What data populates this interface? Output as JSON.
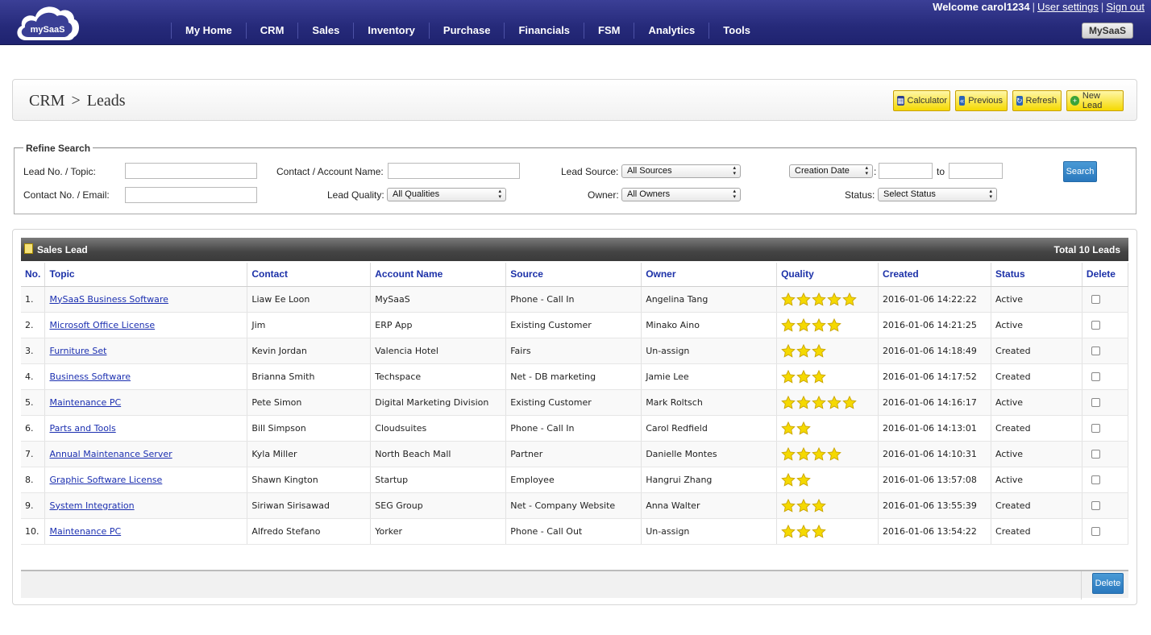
{
  "header": {
    "logo_text": "mySaaS",
    "welcome_prefix": "Welcome",
    "username": "carol1234",
    "user_settings": "User settings",
    "sign_out": "Sign out",
    "brand_button": "MySaaS",
    "nav": [
      "My Home",
      "CRM",
      "Sales",
      "Inventory",
      "Purchase",
      "Financials",
      "FSM",
      "Analytics",
      "Tools"
    ]
  },
  "page": {
    "crumb_root": "CRM",
    "crumb_sep": ">",
    "crumb_leaf": "Leads",
    "buttons": {
      "calculator": "Calculator",
      "previous": "Previous",
      "refresh": "Refresh",
      "new_lead": "New Lead"
    }
  },
  "search": {
    "legend": "Refine Search",
    "lead_no_label": "Lead No. / Topic:",
    "contact_no_label": "Contact No. / Email:",
    "contact_account_label": "Contact / Account Name:",
    "lead_quality_label": "Lead Quality:",
    "lead_quality_value": "All Qualities",
    "lead_source_label": "Lead Source:",
    "lead_source_value": "All Sources",
    "owner_label": "Owner:",
    "owner_value": "All Owners",
    "date_field_value": "Creation Date",
    "date_colon": ":",
    "to_label": "to",
    "status_label": "Status:",
    "status_value": "Select Status",
    "search_button": "Search"
  },
  "grid": {
    "title": "Sales Lead",
    "total": "Total 10 Leads",
    "columns": [
      "No.",
      "Topic",
      "Contact",
      "Account Name",
      "Source",
      "Owner",
      "Quality",
      "Created",
      "Status",
      "Delete"
    ],
    "rows": [
      {
        "no": "1.",
        "topic": "MySaaS Business Software",
        "contact": "Liaw Ee Loon",
        "account": "MySaaS",
        "source": "Phone - Call In",
        "owner": "Angelina Tang",
        "quality": 5,
        "created": "2016-01-06 14:22:22",
        "status": "Active"
      },
      {
        "no": "2.",
        "topic": "Microsoft Office License",
        "contact": "Jim",
        "account": "ERP App",
        "source": "Existing Customer",
        "owner": "Minako Aino",
        "quality": 4,
        "created": "2016-01-06 14:21:25",
        "status": "Active"
      },
      {
        "no": "3.",
        "topic": "Furniture Set",
        "contact": "Kevin Jordan",
        "account": "Valencia Hotel",
        "source": "Fairs",
        "owner": "Un-assign",
        "quality": 3,
        "created": "2016-01-06 14:18:49",
        "status": "Created"
      },
      {
        "no": "4.",
        "topic": "Business Software",
        "contact": "Brianna Smith",
        "account": "Techspace",
        "source": "Net - DB marketing",
        "owner": "Jamie Lee",
        "quality": 3,
        "created": "2016-01-06 14:17:52",
        "status": "Created"
      },
      {
        "no": "5.",
        "topic": "Maintenance PC",
        "contact": "Pete Simon",
        "account": "Digital Marketing Division",
        "source": "Existing Customer",
        "owner": "Mark Roltsch",
        "quality": 5,
        "created": "2016-01-06 14:16:17",
        "status": "Active"
      },
      {
        "no": "6.",
        "topic": "Parts and Tools",
        "contact": "Bill Simpson",
        "account": "Cloudsuites",
        "source": "Phone - Call In",
        "owner": "Carol Redfield",
        "quality": 2,
        "created": "2016-01-06 14:13:01",
        "status": "Created"
      },
      {
        "no": "7.",
        "topic": "Annual Maintenance Server",
        "contact": "Kyla Miller",
        "account": "North Beach Mall",
        "source": "Partner",
        "owner": "Danielle Montes",
        "quality": 4,
        "created": "2016-01-06 14:10:31",
        "status": "Active"
      },
      {
        "no": "8.",
        "topic": "Graphic Software License",
        "contact": "Shawn Kington",
        "account": "Startup",
        "source": "Employee",
        "owner": "Hangrui Zhang",
        "quality": 2,
        "created": "2016-01-06 13:57:08",
        "status": "Active"
      },
      {
        "no": "9.",
        "topic": "System Integration",
        "contact": "Siriwan Sirisawad",
        "account": "SEG Group",
        "source": "Net - Company Website",
        "owner": "Anna Walter",
        "quality": 3,
        "created": "2016-01-06 13:55:39",
        "status": "Created"
      },
      {
        "no": "10.",
        "topic": "Maintenance PC",
        "contact": "Alfredo Stefano",
        "account": "Yorker",
        "source": "Phone - Call Out",
        "owner": "Un-assign",
        "quality": 3,
        "created": "2016-01-06 13:54:22",
        "status": "Created"
      }
    ],
    "delete_button": "Delete"
  },
  "colors": {
    "header": "#262a7a",
    "link": "#1b2fb0",
    "star": "#f5d900",
    "button_blue": "#2a78be",
    "button_yellow": "#f5d900"
  }
}
